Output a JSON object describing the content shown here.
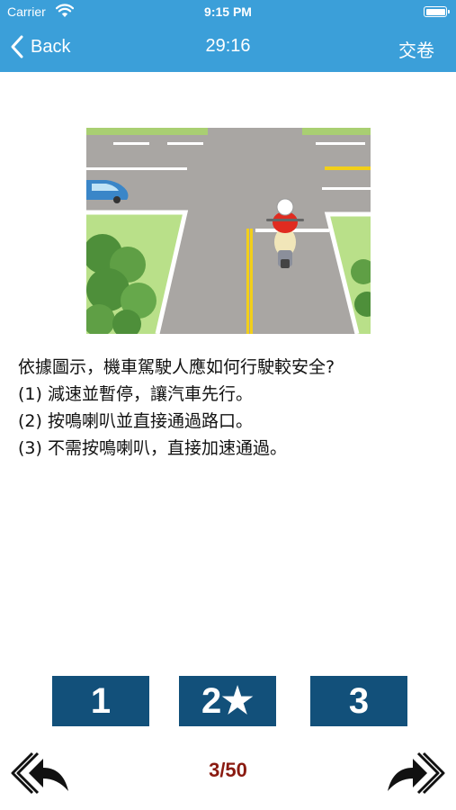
{
  "status_bar": {
    "carrier": "Carrier",
    "time": "9:15 PM"
  },
  "nav": {
    "back_label": "Back",
    "timer": "29:16",
    "submit_label": "交卷",
    "bar_color": "#3b9fd9"
  },
  "question": {
    "prompt": "依據圖示，機車駕駛人應如何行駛較安全?",
    "options": [
      "(1) 減速並暫停，讓汽車先行。",
      "(2) 按鳴喇叭並直接通過路口。",
      "(3) 不需按鳴喇叭，直接加速通過。"
    ]
  },
  "answers": [
    {
      "label": "1",
      "starred": false
    },
    {
      "label": "2★",
      "starred": true
    },
    {
      "label": "3",
      "starred": false
    }
  ],
  "answer_color": "#12507a",
  "footer": {
    "progress": "3/50",
    "progress_color": "#8a1a10"
  },
  "icons": {
    "back": "chevron-left-icon",
    "wifi": "wifi-icon",
    "battery": "battery-icon",
    "prev": "double-arrow-left-icon",
    "next": "double-arrow-right-icon"
  }
}
